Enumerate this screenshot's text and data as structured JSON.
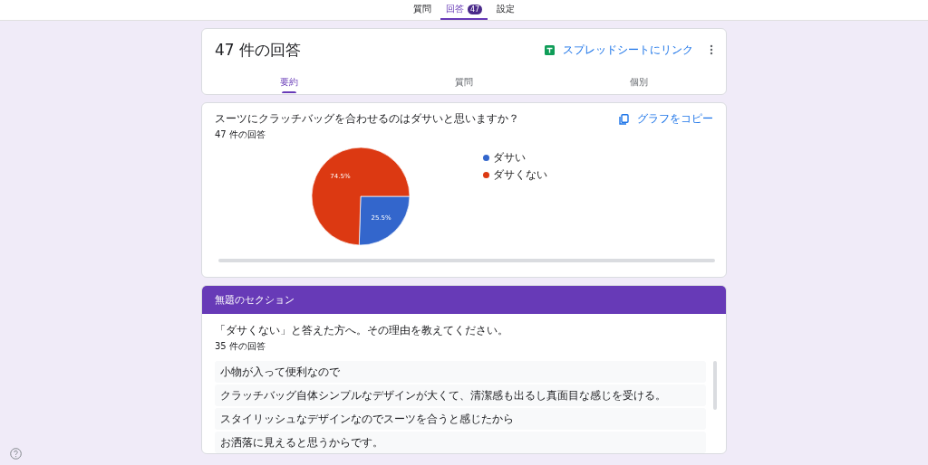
{
  "top_tabs": [
    {
      "label": "質問",
      "selected": false
    },
    {
      "label": "回答",
      "selected": true,
      "badge": "47"
    },
    {
      "label": "設定",
      "selected": false
    }
  ],
  "summary": {
    "title": "47 件の回答",
    "link_label": "スプレッドシートにリンク",
    "tabs": [
      {
        "label": "要約",
        "selected": true
      },
      {
        "label": "質問",
        "selected": false
      },
      {
        "label": "個別",
        "selected": false
      }
    ]
  },
  "question_card": {
    "question": "スーツにクラッチバッグを合わせるのはダサいと思いますか？",
    "count": "47 件の回答",
    "copy_label": "グラフをコピー",
    "legend": [
      {
        "label": "ダサい",
        "color": "#3366cc"
      },
      {
        "label": "ダサくない",
        "color": "#dc3912"
      }
    ],
    "chart_data": {
      "type": "pie",
      "values": [
        25.5,
        74.5
      ],
      "value_labels": [
        "25.5%",
        "74.5%"
      ]
    }
  },
  "section": {
    "title": "無題のセクション",
    "question": "「ダサくない」と答えた方へ。その理由を教えてください。",
    "count": "35 件の回答",
    "responses": [
      "小物が入って便利なので",
      "クラッチバッグ自体シンプルなデザインが大くて、清潔感も出るし真面目な感じを受ける。",
      "スタイリッシュなデザインなのでスーツを合うと感じたから",
      "お洒落に見えると思うからです。"
    ]
  }
}
